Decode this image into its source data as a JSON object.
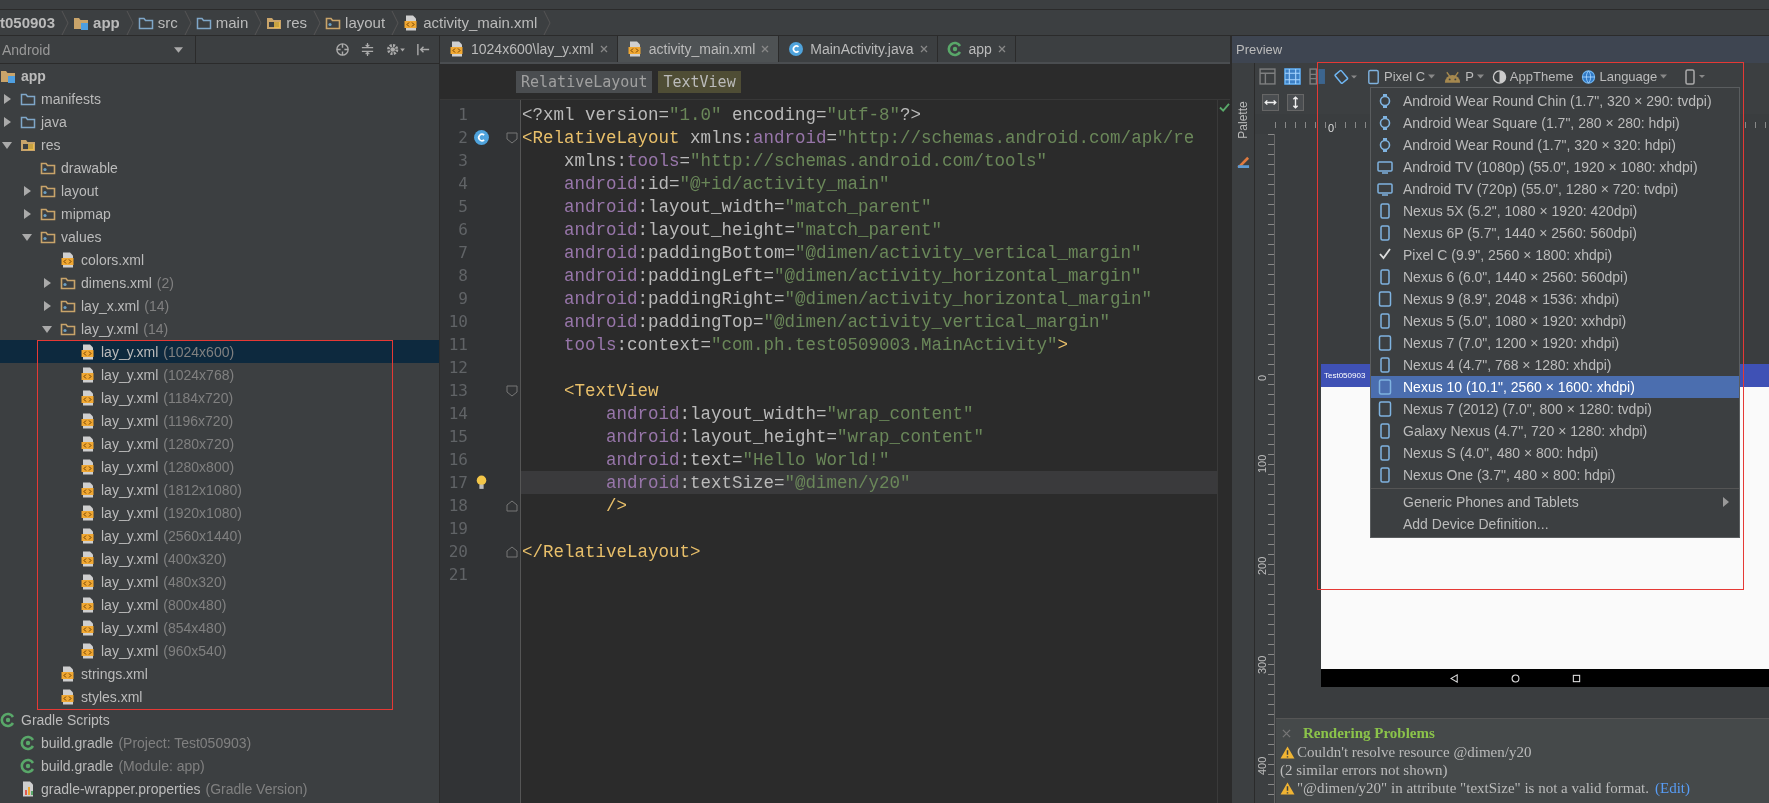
{
  "breadcrumb": [
    {
      "label": "t050903",
      "kind": "none",
      "bold": true
    },
    {
      "label": "app",
      "kind": "module",
      "bold": true
    },
    {
      "label": "src",
      "kind": "folder",
      "bold": false
    },
    {
      "label": "main",
      "kind": "folder",
      "bold": false
    },
    {
      "label": "res",
      "kind": "res-folder",
      "bold": false
    },
    {
      "label": "layout",
      "kind": "pkg-folder",
      "bold": false
    },
    {
      "label": "activity_main.xml",
      "kind": "xml",
      "bold": false
    }
  ],
  "project_panel": {
    "view": "Android",
    "tree": [
      {
        "label": "app",
        "kind": "module",
        "selected": false,
        "children": [
          {
            "label": "manifests",
            "kind": "folder",
            "expanded": false,
            "selected": false
          },
          {
            "label": "java",
            "kind": "folder",
            "expanded": false,
            "selected": false
          },
          {
            "label": "res",
            "kind": "res-folder",
            "expanded": true,
            "selected": false,
            "children": [
              {
                "label": "drawable",
                "kind": "pkg-folder",
                "selected": false
              },
              {
                "label": "layout",
                "kind": "pkg-folder",
                "expanded": false,
                "selected": false
              },
              {
                "label": "mipmap",
                "kind": "pkg-folder",
                "expanded": false,
                "selected": false
              },
              {
                "label": "values",
                "kind": "pkg-folder",
                "expanded": true,
                "selected": false,
                "children": [
                  {
                    "label": "colors.xml",
                    "kind": "xml",
                    "selected": false
                  },
                  {
                    "label": "dimens.xml",
                    "note": "(2)",
                    "kind": "pkg-folder",
                    "expanded": false,
                    "selected": false
                  },
                  {
                    "label": "lay_x.xml",
                    "note": "(14)",
                    "kind": "pkg-folder",
                    "expanded": false,
                    "selected": false
                  },
                  {
                    "label": "lay_y.xml",
                    "note": "(14)",
                    "kind": "pkg-folder",
                    "expanded": true,
                    "selected": false,
                    "children": [
                      {
                        "label": "lay_y.xml",
                        "note": "(1024x600)",
                        "kind": "xml",
                        "selected": true
                      },
                      {
                        "label": "lay_y.xml",
                        "note": "(1024x768)",
                        "kind": "xml",
                        "selected": false
                      },
                      {
                        "label": "lay_y.xml",
                        "note": "(1184x720)",
                        "kind": "xml",
                        "selected": false
                      },
                      {
                        "label": "lay_y.xml",
                        "note": "(1196x720)",
                        "kind": "xml",
                        "selected": false
                      },
                      {
                        "label": "lay_y.xml",
                        "note": "(1280x720)",
                        "kind": "xml",
                        "selected": false
                      },
                      {
                        "label": "lay_y.xml",
                        "note": "(1280x800)",
                        "kind": "xml",
                        "selected": false
                      },
                      {
                        "label": "lay_y.xml",
                        "note": "(1812x1080)",
                        "kind": "xml",
                        "selected": false
                      },
                      {
                        "label": "lay_y.xml",
                        "note": "(1920x1080)",
                        "kind": "xml",
                        "selected": false
                      },
                      {
                        "label": "lay_y.xml",
                        "note": "(2560x1440)",
                        "kind": "xml",
                        "selected": false
                      },
                      {
                        "label": "lay_y.xml",
                        "note": "(400x320)",
                        "kind": "xml",
                        "selected": false
                      },
                      {
                        "label": "lay_y.xml",
                        "note": "(480x320)",
                        "kind": "xml",
                        "selected": false
                      },
                      {
                        "label": "lay_y.xml",
                        "note": "(800x480)",
                        "kind": "xml",
                        "selected": false
                      },
                      {
                        "label": "lay_y.xml",
                        "note": "(854x480)",
                        "kind": "xml",
                        "selected": false
                      },
                      {
                        "label": "lay_y.xml",
                        "note": "(960x540)",
                        "kind": "xml",
                        "selected": false
                      }
                    ]
                  },
                  {
                    "label": "strings.xml",
                    "kind": "xml",
                    "selected": false
                  },
                  {
                    "label": "styles.xml",
                    "kind": "xml",
                    "selected": false
                  }
                ]
              }
            ]
          }
        ]
      },
      {
        "label": "Gradle Scripts",
        "kind": "gradle",
        "selected": false,
        "children": [
          {
            "label": "build.gradle",
            "note": "(Project: Test050903)",
            "kind": "gradle",
            "selected": false
          },
          {
            "label": "build.gradle",
            "note": "(Module: app)",
            "kind": "gradle",
            "selected": false
          },
          {
            "label": "gradle-wrapper.properties",
            "note": "(Gradle Version)",
            "kind": "properties",
            "selected": false
          }
        ]
      }
    ]
  },
  "editor": {
    "tabs": [
      {
        "label": "1024x600\\lay_y.xml",
        "kind": "xml",
        "selected": false
      },
      {
        "label": "activity_main.xml",
        "kind": "xml",
        "selected": true
      },
      {
        "label": "MainActivity.java",
        "kind": "class",
        "selected": false
      },
      {
        "label": "app",
        "kind": "gradle",
        "selected": false
      }
    ],
    "path": [
      {
        "label": "RelativeLayout",
        "selected": false
      },
      {
        "label": "TextView",
        "selected": true
      }
    ],
    "lines": [
      {
        "number": "1",
        "current": false,
        "tokens": [
          {
            "text": "<?xml version=",
            "kind": "plain"
          },
          {
            "text": "\"1.0\"",
            "kind": "value"
          },
          {
            "text": " encoding=",
            "kind": "plain"
          },
          {
            "text": "\"utf-8\"",
            "kind": "value"
          },
          {
            "text": "?>",
            "kind": "plain"
          }
        ]
      },
      {
        "number": "2",
        "current": false,
        "tokens": [
          {
            "text": "<RelativeLayout",
            "kind": "open"
          },
          {
            "text": " xmlns:",
            "kind": "plain"
          },
          {
            "text": "android",
            "kind": "ns"
          },
          {
            "text": "=",
            "kind": "plain"
          },
          {
            "text": "\"http://schemas.android.com/apk/re",
            "kind": "value"
          }
        ]
      },
      {
        "number": "3",
        "current": false,
        "tokens": [
          {
            "text": "    xmlns:",
            "kind": "plain"
          },
          {
            "text": "tools",
            "kind": "ns"
          },
          {
            "text": "=",
            "kind": "plain"
          },
          {
            "text": "\"http://schemas.android.com/tools\"",
            "kind": "value"
          }
        ]
      },
      {
        "number": "4",
        "current": false,
        "tokens": [
          {
            "text": "    android",
            "kind": "ns"
          },
          {
            "text": ":id=",
            "kind": "plain"
          },
          {
            "text": "\"@+id/activity_main\"",
            "kind": "value"
          }
        ]
      },
      {
        "number": "5",
        "current": false,
        "tokens": [
          {
            "text": "    android",
            "kind": "ns"
          },
          {
            "text": ":layout_width=",
            "kind": "plain"
          },
          {
            "text": "\"match_parent\"",
            "kind": "value"
          }
        ]
      },
      {
        "number": "6",
        "current": false,
        "tokens": [
          {
            "text": "    android",
            "kind": "ns"
          },
          {
            "text": ":layout_height=",
            "kind": "plain"
          },
          {
            "text": "\"match_parent\"",
            "kind": "value"
          }
        ]
      },
      {
        "number": "7",
        "current": false,
        "tokens": [
          {
            "text": "    android",
            "kind": "ns"
          },
          {
            "text": ":paddingBottom=",
            "kind": "plain"
          },
          {
            "text": "\"@dimen/activity_vertical_margin\"",
            "kind": "value"
          }
        ]
      },
      {
        "number": "8",
        "current": false,
        "tokens": [
          {
            "text": "    android",
            "kind": "ns"
          },
          {
            "text": ":paddingLeft=",
            "kind": "plain"
          },
          {
            "text": "\"@dimen/activity_horizontal_margin\"",
            "kind": "value"
          }
        ]
      },
      {
        "number": "9",
        "current": false,
        "tokens": [
          {
            "text": "    android",
            "kind": "ns"
          },
          {
            "text": ":paddingRight=",
            "kind": "plain"
          },
          {
            "text": "\"@dimen/activity_horizontal_margin\"",
            "kind": "value"
          }
        ]
      },
      {
        "number": "10",
        "current": false,
        "tokens": [
          {
            "text": "    android",
            "kind": "ns"
          },
          {
            "text": ":paddingTop=",
            "kind": "plain"
          },
          {
            "text": "\"@dimen/activity_vertical_margin\"",
            "kind": "value"
          }
        ]
      },
      {
        "number": "11",
        "current": false,
        "tokens": [
          {
            "text": "    tools",
            "kind": "ns"
          },
          {
            "text": ":context=",
            "kind": "plain"
          },
          {
            "text": "\"com.ph.test0509003.MainActivity\"",
            "kind": "value"
          },
          {
            "text": ">",
            "kind": "tag"
          }
        ]
      },
      {
        "number": "12",
        "current": false
      },
      {
        "number": "13",
        "current": false,
        "tokens": [
          {
            "text": "    <TextView",
            "kind": "open"
          }
        ]
      },
      {
        "number": "14",
        "current": false,
        "tokens": [
          {
            "text": "        android",
            "kind": "ns"
          },
          {
            "text": ":layout_width=",
            "kind": "plain"
          },
          {
            "text": "\"wrap_content\"",
            "kind": "value"
          }
        ]
      },
      {
        "number": "15",
        "current": false,
        "tokens": [
          {
            "text": "        android",
            "kind": "ns"
          },
          {
            "text": ":layout_height=",
            "kind": "plain"
          },
          {
            "text": "\"wrap_content\"",
            "kind": "value"
          }
        ]
      },
      {
        "number": "16",
        "current": false,
        "tokens": [
          {
            "text": "        android",
            "kind": "ns"
          },
          {
            "text": ":text=",
            "kind": "plain"
          },
          {
            "text": "\"Hello World!\"",
            "kind": "value"
          }
        ]
      },
      {
        "number": "17",
        "current": true,
        "tokens": [
          {
            "text": "        android",
            "kind": "ns"
          },
          {
            "text": ":textSize=",
            "kind": "plain"
          },
          {
            "text": "\"@dimen/y20\"",
            "kind": "value"
          }
        ]
      },
      {
        "number": "18",
        "current": false,
        "tokens": [
          {
            "text": "        />",
            "kind": "close"
          }
        ]
      },
      {
        "number": "19",
        "current": false
      },
      {
        "number": "20",
        "current": false,
        "tokens": [
          {
            "text": "</RelativeLayout>",
            "kind": "close"
          }
        ]
      },
      {
        "number": "21",
        "current": false
      }
    ]
  },
  "preview": {
    "title": "Preview",
    "palette": "Palette",
    "view_modes": [
      {
        "kind": "design",
        "selected": false
      },
      {
        "kind": "blueprint",
        "selected": true
      },
      {
        "kind": "both",
        "selected": false
      }
    ],
    "toolbar": {
      "device": "Pixel C",
      "api": "P",
      "theme": "AppTheme",
      "language": "Language"
    },
    "ruler": {
      "horizontal": [
        "0"
      ],
      "vertical": [
        "0",
        "100",
        "200",
        "300",
        "400"
      ]
    },
    "app_title": "Test050903",
    "device_menu": {
      "devices": [
        {
          "label": "Android Wear Round Chin (1.7\", 320 × 290: tvdpi)",
          "kind": "watch",
          "checked": false,
          "highlighted": false
        },
        {
          "label": "Android Wear Square (1.7\", 280 × 280: hdpi)",
          "kind": "watch",
          "checked": false,
          "highlighted": false
        },
        {
          "label": "Android Wear Round (1.7\", 320 × 320: hdpi)",
          "kind": "watch",
          "checked": false,
          "highlighted": false
        },
        {
          "label": "Android TV (1080p) (55.0\", 1920 × 1080: xhdpi)",
          "kind": "tv",
          "checked": false,
          "highlighted": false
        },
        {
          "label": "Android TV (720p) (55.0\", 1280 × 720: tvdpi)",
          "kind": "tv",
          "checked": false,
          "highlighted": false
        },
        {
          "label": "Nexus 5X (5.2\", 1080 × 1920: 420dpi)",
          "kind": "phone",
          "checked": false,
          "highlighted": false
        },
        {
          "label": "Nexus 6P (5.7\", 1440 × 2560: 560dpi)",
          "kind": "phone",
          "checked": false,
          "highlighted": false
        },
        {
          "label": "Pixel C (9.9\", 2560 × 1800: xhdpi)",
          "checked": true,
          "highlighted": false
        },
        {
          "label": "Nexus 6 (6.0\", 1440 × 2560: 560dpi)",
          "kind": "phone",
          "checked": false,
          "highlighted": false
        },
        {
          "label": "Nexus 9 (8.9\", 2048 × 1536: xhdpi)",
          "kind": "tablet",
          "checked": false,
          "highlighted": false
        },
        {
          "label": "Nexus 5 (5.0\", 1080 × 1920: xxhdpi)",
          "kind": "phone",
          "checked": false,
          "highlighted": false
        },
        {
          "label": "Nexus 7 (7.0\", 1200 × 1920: xhdpi)",
          "kind": "tablet",
          "checked": false,
          "highlighted": false
        },
        {
          "label": "Nexus 4 (4.7\", 768 × 1280: xhdpi)",
          "kind": "phone",
          "checked": false,
          "highlighted": false
        },
        {
          "label": "Nexus 10 (10.1\", 2560 × 1600: xhdpi)",
          "kind": "tablet",
          "checked": false,
          "highlighted": true
        },
        {
          "label": "Nexus 7 (2012) (7.0\", 800 × 1280: tvdpi)",
          "kind": "tablet",
          "checked": false,
          "highlighted": false
        },
        {
          "label": "Galaxy Nexus (4.7\", 720 × 1280: xhdpi)",
          "kind": "phone",
          "checked": false,
          "highlighted": false
        },
        {
          "label": "Nexus S (4.0\", 480 × 800: hdpi)",
          "kind": "phone",
          "checked": false,
          "highlighted": false
        },
        {
          "label": "Nexus One (3.7\", 480 × 800: hdpi)",
          "kind": "phone",
          "checked": false,
          "highlighted": false
        }
      ],
      "more": [
        {
          "label": "Generic Phones and Tablets",
          "kind": "submenu"
        },
        {
          "label": "Add Device Definition...",
          "kind": "action"
        }
      ]
    },
    "problems": {
      "title": "Rendering Problems",
      "messages": [
        {
          "kind": "warning",
          "text": "Couldn't resolve resource @dimen/y20"
        },
        {
          "kind": "plain",
          "text": "(2 similar errors not shown)"
        },
        {
          "kind": "warning",
          "text": "\"@dimen/y20\" in attribute \"textSize\" is not a valid format.",
          "link": "(Edit)"
        }
      ]
    }
  }
}
